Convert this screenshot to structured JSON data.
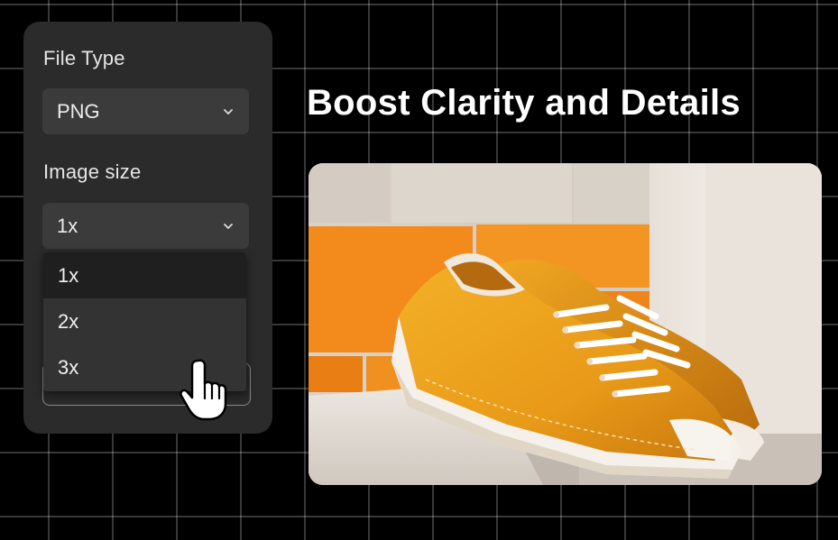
{
  "panel": {
    "file_type_label": "File Type",
    "file_type_value": "PNG",
    "image_size_label": "Image size",
    "image_size_value": "1x",
    "image_size_options": [
      "1x",
      "2x",
      "3x"
    ],
    "selected_option": "1x"
  },
  "headline": "Boost Clarity and Details",
  "icons": {
    "chevron": "chevron-down-icon",
    "cursor": "hand-pointer-icon"
  },
  "colors": {
    "background": "#000000",
    "panel": "#2b2b2b",
    "select": "#3b3b3b",
    "shoe_orange": "#f0a020",
    "wall_orange": "#f28a1c"
  }
}
